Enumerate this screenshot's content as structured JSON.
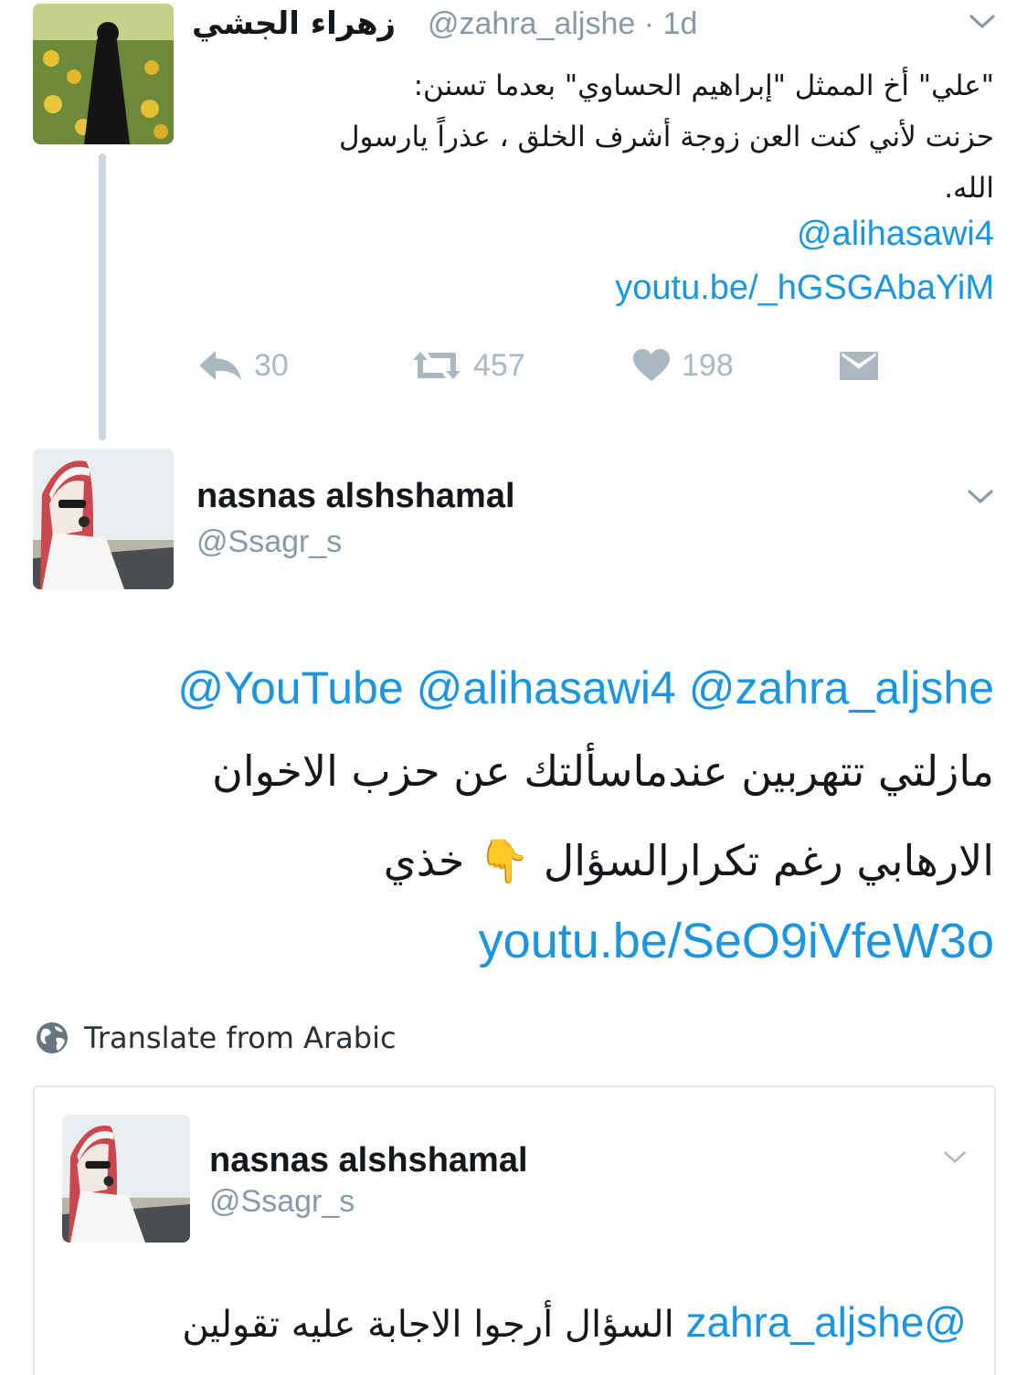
{
  "tweet1": {
    "display_name": "زهراء الجشي",
    "handle": "@zahra_aljshe",
    "time": "· 1d",
    "text_lines": [
      "\"علي\" أخ الممثل \"إبراهيم الحساوي\" بعدما تسنن:",
      "حزنت لأني كنت العن زوجة أشرف الخلق ، عذراً يارسول",
      "الله."
    ],
    "mention": "@alihasawi4",
    "link": "youtu.be/_hGSGAbaYiM",
    "actions": {
      "replies": "30",
      "retweets": "457",
      "likes": "198"
    }
  },
  "tweet2": {
    "display_name": "nasnas alshshamal",
    "handle": "@Ssagr_s",
    "mentions": [
      "@YouTube",
      "@alihasawi4",
      "@zahra_aljshe"
    ],
    "text_line1": "مازلتي تتهربين عندماسألتك عن حزب الاخوان",
    "text_line2_before": "الارهابي رغم تكرارالسؤال",
    "emoji": "👇",
    "text_line2_after": "خذي",
    "link": "youtu.be/SeO9iVfeW3o",
    "translate_label": "Translate from Arabic"
  },
  "quoted_tweet": {
    "display_name": "nasnas alshshamal",
    "handle": "@Ssagr_s",
    "mention": "@zahra_aljshe",
    "text": "السؤال أرجوا الاجابة عليه تقولين"
  },
  "colors": {
    "link": "#1b95e0",
    "muted": "#8899a6",
    "icon": "#aab8c2",
    "thread_line": "#ccd6dd"
  },
  "icons": [
    "chevron-down-icon",
    "reply-icon",
    "retweet-icon",
    "like-icon",
    "direct-message-icon",
    "globe-icon"
  ]
}
